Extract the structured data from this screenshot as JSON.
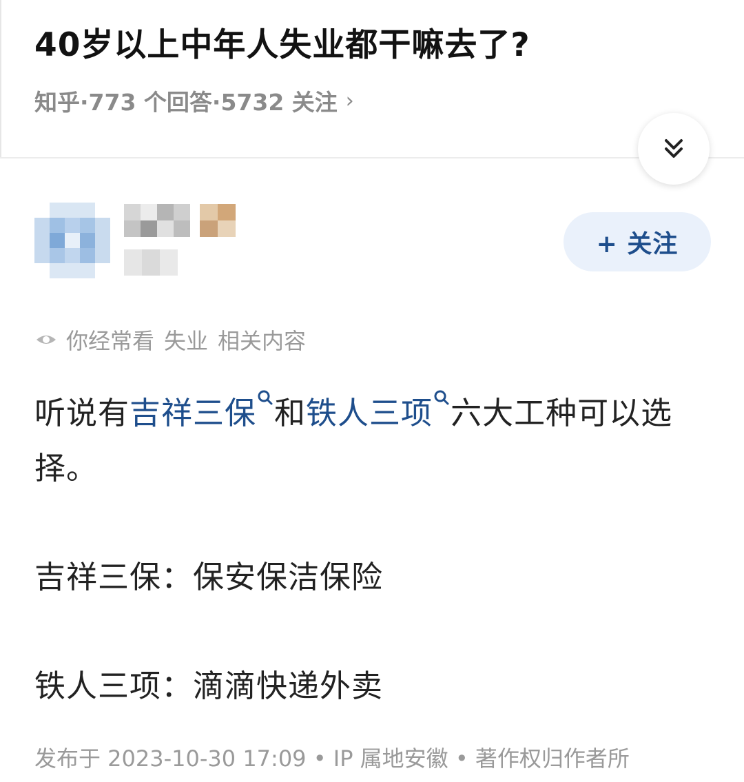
{
  "question": {
    "title": "40岁以上中年人失业都干嘛去了?",
    "meta": "知乎·773 个回答·5732 关注",
    "chevron": "›"
  },
  "icons": {
    "collapse": "double-chevron-down-icon",
    "eye": "eye-icon",
    "search": "search-icon"
  },
  "answer": {
    "follow_label": "+ 关注",
    "hint_prefix": "你经常看",
    "hint_topic": "失业",
    "hint_suffix": "相关内容",
    "para1_a": "听说有",
    "link1": "吉祥三保",
    "para1_b": "和",
    "link2": "铁人三项",
    "para1_c": "六大工种可以选择。",
    "para2": "吉祥三保：保安保洁保险",
    "para3": "铁人三项：滴滴快递外卖",
    "footer": "发布于 2023-10-30 17:09 • IP 属地安徽 • 著作权归作者所"
  },
  "colors": {
    "link": "#1e4e8c",
    "follow_bg": "#eaf1fb",
    "muted": "#9a9a9a"
  }
}
